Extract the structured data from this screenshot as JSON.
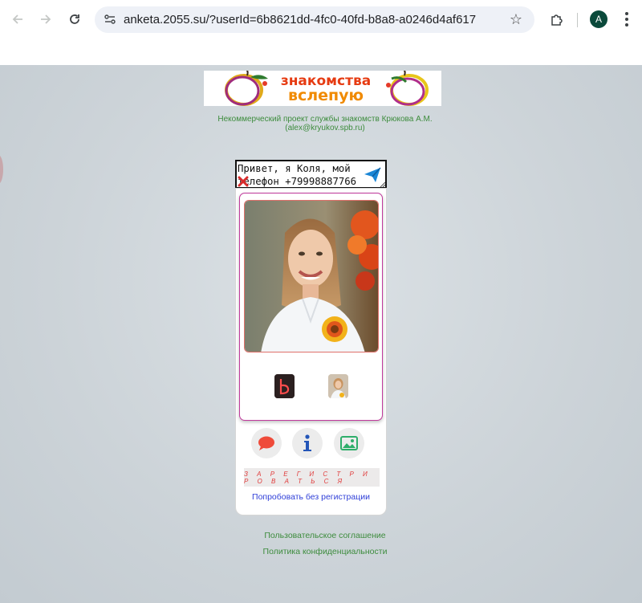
{
  "browser": {
    "url": "anketa.2055.su/?userId=6b8621dd-4fc0-40fd-b8a8-a0246d4af617",
    "profile_initial": "A"
  },
  "header": {
    "banner_line1": "знакомства",
    "banner_line2": "вслепую",
    "subtitle_line1": "Некоммерческий проект службы знакомств Крюкова А.М.",
    "subtitle_line2": "(alex@kryukov.spb.ru)"
  },
  "message": {
    "value": "Привет, я Коля, мой\nтелефон +79998887766"
  },
  "profile": {
    "register_label": "З А Р Е Г И С Т Р И Р О В А Т Ь С Я",
    "try_label": "Попробовать без регистрации"
  },
  "footer": {
    "agreement": "Пользовательское соглашение",
    "privacy": "Политика конфиденциальности"
  },
  "colors": {
    "link_green": "#3d8c3d",
    "card_border": "#c0399c",
    "register_text": "#e03a3a",
    "try_link": "#2f3fd8"
  }
}
